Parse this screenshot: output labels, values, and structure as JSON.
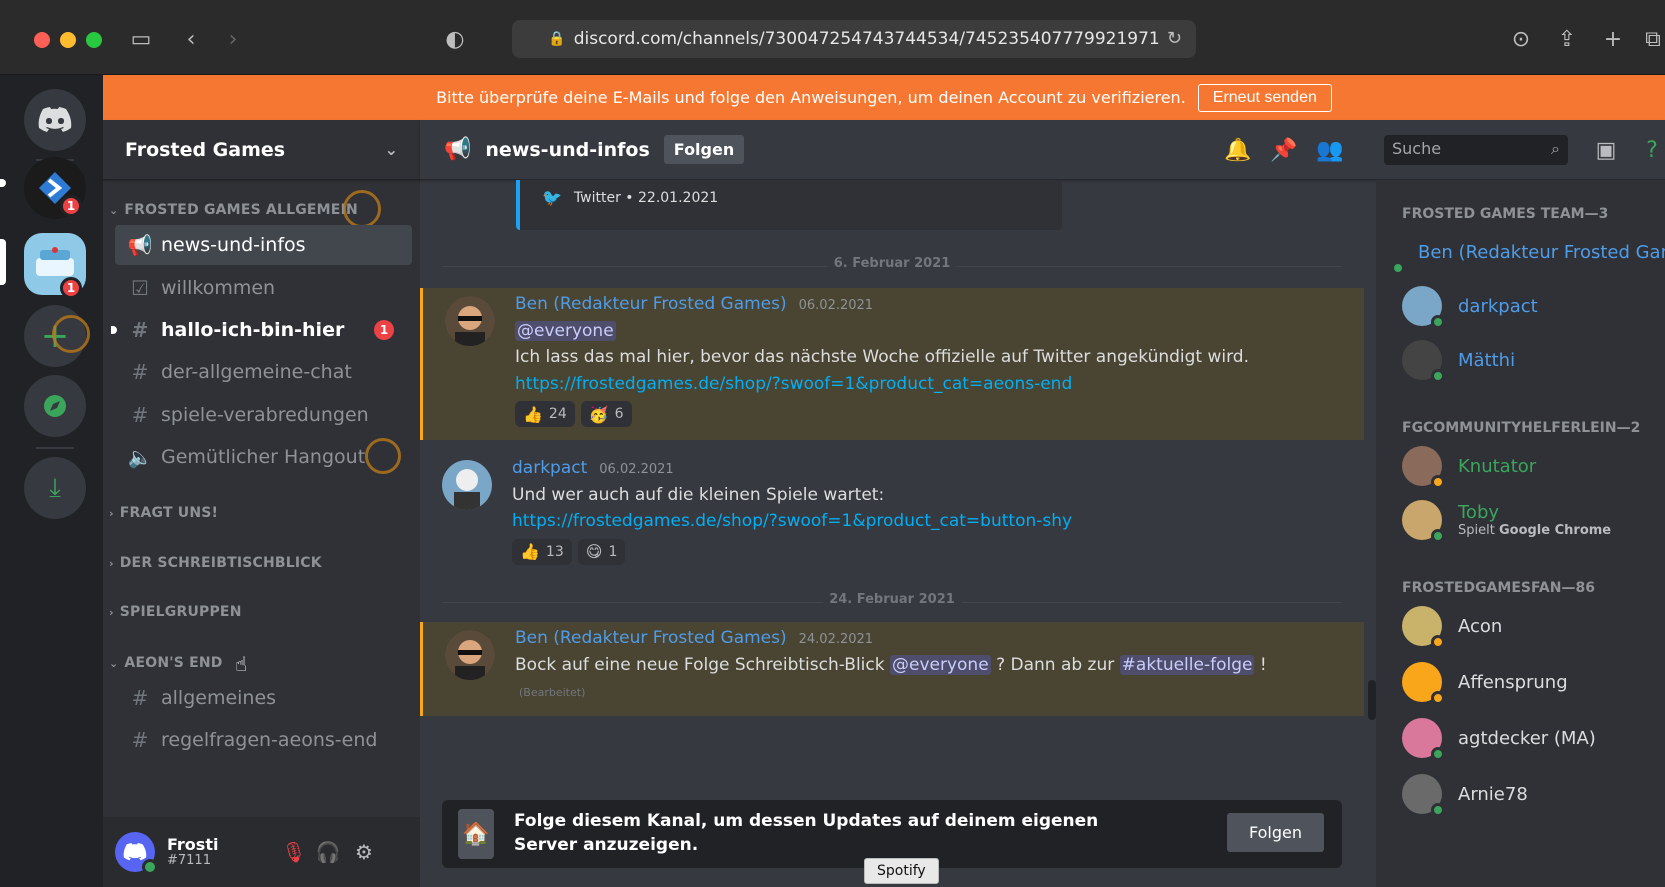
{
  "browser": {
    "url": "discord.com/channels/730047254743744534/745235407779921971"
  },
  "banner": {
    "text": "Bitte überprüfe deine E-Mails und folge den Anweisungen, um deinen Account zu verifizieren.",
    "button": "Erneut senden"
  },
  "rail": {
    "badges": [
      "1",
      "1"
    ]
  },
  "guild": {
    "name": "Frosted Games"
  },
  "categories": {
    "c1": "FROSTED GAMES ALLGEMEIN",
    "c2": "FRAGT UNS!",
    "c3": "DER SCHREIBTISCHBLICK",
    "c4": "SPIELGRUPPEN",
    "c5": "AEON'S END"
  },
  "channels": [
    {
      "name": "news-und-infos"
    },
    {
      "name": "willkommen"
    },
    {
      "name": "hallo-ich-bin-hier",
      "badge": "1"
    },
    {
      "name": "der-allgemeine-chat"
    },
    {
      "name": "spiele-verabredungen"
    },
    {
      "name": "Gemütlicher Hangout"
    },
    {
      "name": "allgemeines"
    },
    {
      "name": "regelfragen-aeons-end"
    }
  ],
  "user": {
    "name": "Frosti",
    "tag": "#7111"
  },
  "header": {
    "channel": "news-und-infos",
    "follow": "Folgen",
    "search_placeholder": "Suche"
  },
  "embed": {
    "footer": "Twitter • 22.01.2021"
  },
  "dividers": [
    "6. Februar 2021",
    "24. Februar 2021"
  ],
  "messages": [
    {
      "author": "Ben (Redakteur Frosted Games)",
      "time": "06.02.2021",
      "mention": "@everyone",
      "line": "Ich lass das mal hier, bevor das nächste Woche offizielle auf Twitter angekündigt wird.",
      "link": "https://frostedgames.de/shop/?swoof=1&product_cat=aeons-end",
      "reactions": [
        {
          "emoji": "👍",
          "count": "24"
        },
        {
          "emoji": "🥳",
          "count": "6"
        }
      ]
    },
    {
      "author": "darkpact",
      "time": "06.02.2021",
      "line": "Und wer auch auf die kleinen Spiele wartet:",
      "link": "https://frostedgames.de/shop/?swoof=1&product_cat=button-shy",
      "reactions": [
        {
          "emoji": "👍",
          "count": "13"
        },
        {
          "emoji": "😋",
          "count": "1"
        }
      ]
    },
    {
      "author": "Ben (Redakteur Frosted Games)",
      "time": "24.02.2021",
      "pre": "Bock auf eine neue Folge Schreibtisch-Blick",
      "mention": "@everyone",
      "mid": "? Dann ab zur",
      "channel_mention": "#aktuelle-folge",
      "post": "!",
      "edited": "(Bearbeitet)"
    }
  ],
  "followbar": {
    "text": "Folge diesem Kanal, um dessen Updates auf deinem eigenen Server anzuzeigen.",
    "button": "Folgen"
  },
  "member_groups": {
    "g1": "FROSTED GAMES TEAM—3",
    "g2": "FGCOMMUNITYHELFERLEIN—2",
    "g3": "FROSTEDGAMESFAN—86"
  },
  "members": [
    {
      "name": "Ben (Redakteur Frosted Games)",
      "color": "#4f9ce8"
    },
    {
      "name": "darkpact",
      "color": "#4f9ce8"
    },
    {
      "name": "Mätthi",
      "color": "#4f9ce8"
    },
    {
      "name": "Knutator",
      "color": "#3ba55c"
    },
    {
      "name": "Toby",
      "color": "#3ba55c",
      "activity_prefix": "Spielt",
      "activity": "Google Chrome"
    },
    {
      "name": "Acon",
      "color": "#dcddde"
    },
    {
      "name": "Affensprung",
      "color": "#dcddde"
    },
    {
      "name": "agtdecker (MA)",
      "color": "#dcddde"
    },
    {
      "name": "Arnie78",
      "color": "#dcddde"
    }
  ],
  "tooltip": "Spotify"
}
